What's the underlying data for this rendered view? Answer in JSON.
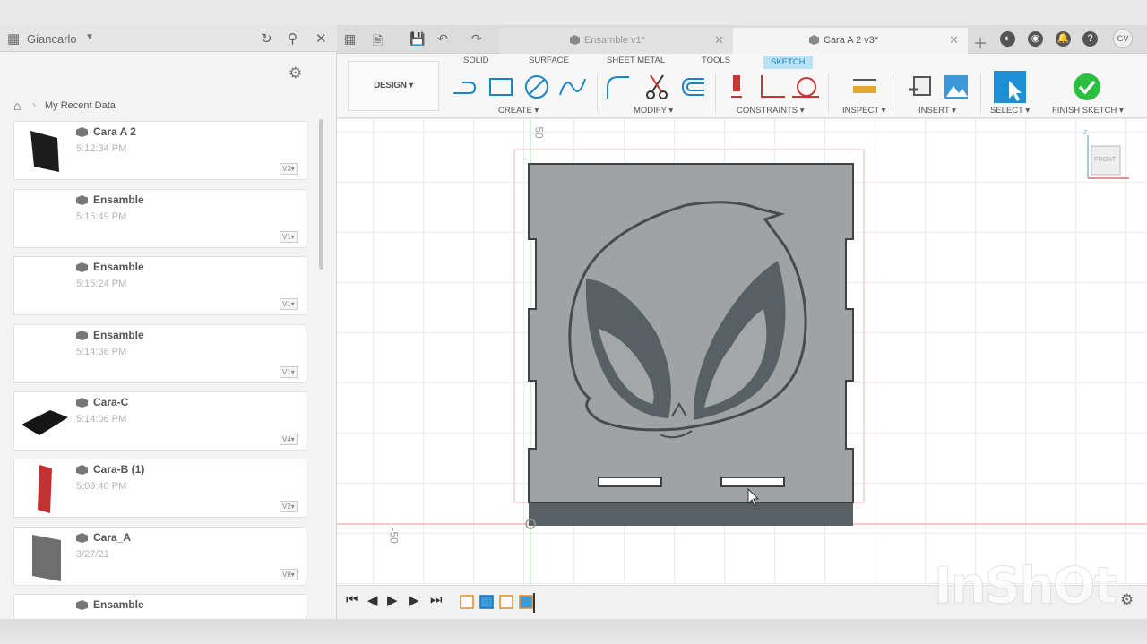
{
  "left_panel": {
    "user_name": "Giancarlo",
    "breadcrumb": "My Recent Data",
    "files": [
      {
        "name": "Cara A 2",
        "time": "5:12:34 PM",
        "version": "V3"
      },
      {
        "name": "Ensamble",
        "time": "5:15:49 PM",
        "version": "V1"
      },
      {
        "name": "Ensamble",
        "time": "5:15:24 PM",
        "version": "V1"
      },
      {
        "name": "Ensamble",
        "time": "5:14:36 PM",
        "version": "V1"
      },
      {
        "name": "Cara-C",
        "time": "5:14:06 PM",
        "version": "V4"
      },
      {
        "name": "Cara-B (1)",
        "time": "5:09:40 PM",
        "version": "V2"
      },
      {
        "name": "Cara_A",
        "time": "3/27/21",
        "version": "V8"
      },
      {
        "name": "Ensamble",
        "time": "",
        "version": ""
      }
    ]
  },
  "tabs": {
    "tab1": "Ensamble v1*",
    "tab2": "Cara A 2 v3*",
    "avatar": "GV"
  },
  "toolbar": {
    "workspace": "DESIGN",
    "tabs": [
      "SOLID",
      "SURFACE",
      "SHEET METAL",
      "TOOLS",
      "SKETCH"
    ],
    "groups": {
      "create": "CREATE",
      "modify": "MODIFY",
      "constraints": "CONSTRAINTS",
      "inspect": "INSPECT",
      "insert": "INSERT",
      "select": "SELECT",
      "finish": "FINISH SKETCH"
    }
  },
  "canvas": {
    "ruler_top": "50",
    "ruler_left": "-50",
    "viewcube_label": "FRONT",
    "viewcube_axis": "Z"
  },
  "watermark": "InShOt",
  "colors": {
    "sketch_tab": "#b9e2f5",
    "finish_green": "#2bbf3f",
    "select_blue": "#1e8fd5",
    "part_gray": "#9fa3a6",
    "face_dark": "#586063"
  }
}
